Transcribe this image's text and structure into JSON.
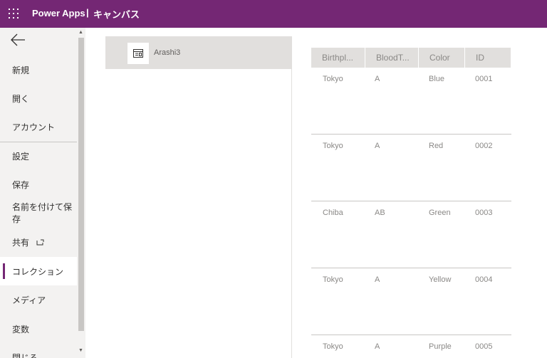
{
  "header": {
    "app_name": "Power Apps",
    "separator": "|",
    "app_type": "キャンバス",
    "bar_color": "#742774"
  },
  "sidebar": {
    "back_icon": "arrow-left-icon",
    "items": [
      {
        "label": "新規"
      },
      {
        "label": "開く"
      },
      {
        "label": "アカウント"
      },
      {
        "label": "設定"
      },
      {
        "label": "保存"
      },
      {
        "label": "名前を付けて保存"
      },
      {
        "label": "共有",
        "icon": "external-share-icon"
      },
      {
        "label": "コレクション",
        "selected": true
      },
      {
        "label": "メディア"
      },
      {
        "label": "変数"
      },
      {
        "label": "閉じる"
      }
    ]
  },
  "collections": {
    "items": [
      {
        "name": "Arashi3",
        "icon": "table-icon",
        "selected": true
      }
    ]
  },
  "table": {
    "columns": [
      "Birthpl...",
      "BloodT...",
      "Color",
      "ID"
    ],
    "rows": [
      [
        "Tokyo",
        "A",
        "Blue",
        "0001"
      ],
      [
        "Tokyo",
        "A",
        "Red",
        "0002"
      ],
      [
        "Chiba",
        "AB",
        "Green",
        "0003"
      ],
      [
        "Tokyo",
        "A",
        "Yellow",
        "0004"
      ],
      [
        "Tokyo",
        "A",
        "Purple",
        "0005"
      ]
    ]
  }
}
